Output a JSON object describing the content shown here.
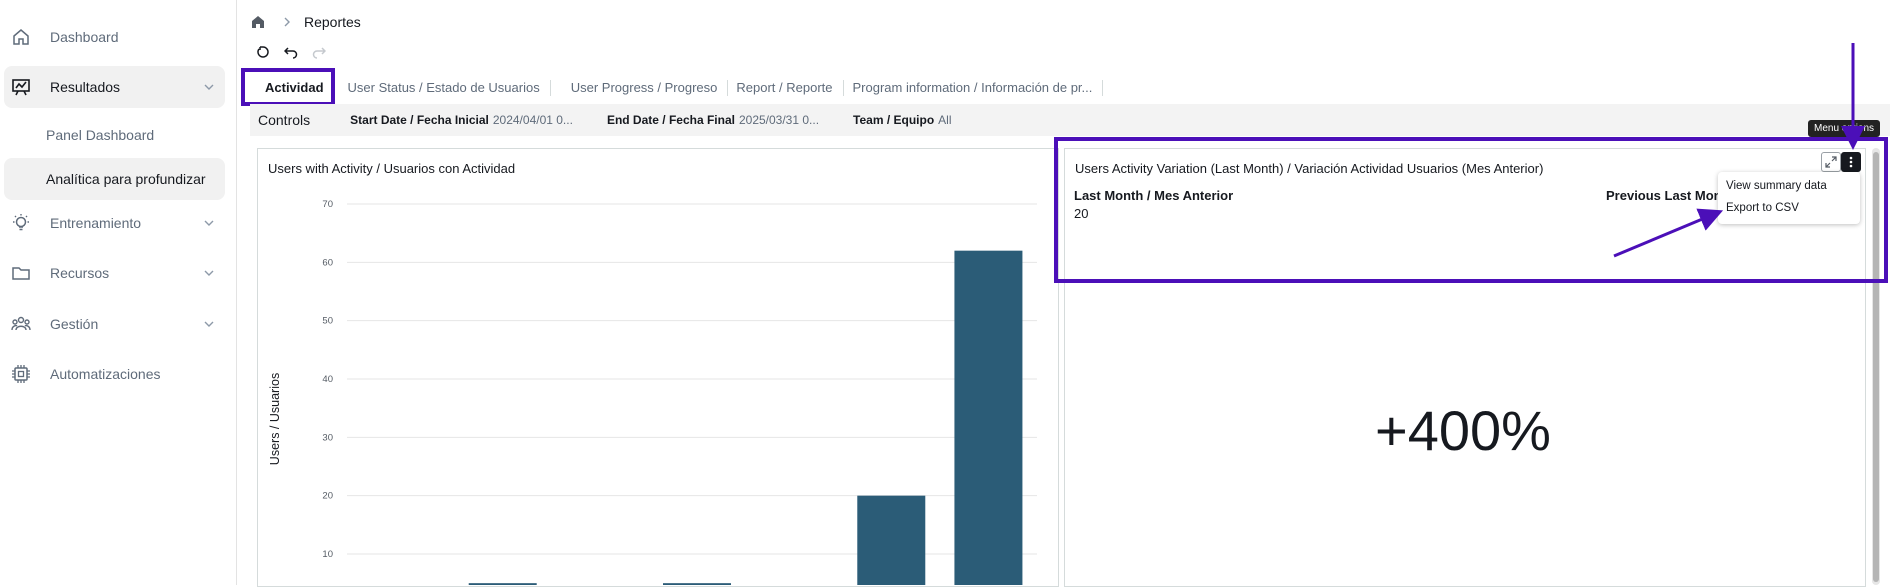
{
  "sidebar": {
    "items": [
      {
        "label": "Dashboard",
        "icon": "home-icon"
      },
      {
        "label": "Resultados",
        "icon": "chart-board-icon"
      },
      {
        "label": "Entrenamiento",
        "icon": "bulb-icon"
      },
      {
        "label": "Recursos",
        "icon": "folder-icon"
      },
      {
        "label": "Gestión",
        "icon": "users-icon"
      },
      {
        "label": "Automatizaciones",
        "icon": "chip-icon"
      }
    ],
    "sub_items": [
      {
        "label": "Panel Dashboard"
      },
      {
        "label": "Analítica para profundizar"
      }
    ]
  },
  "breadcrumb": {
    "current": "Reportes"
  },
  "tabs": [
    {
      "label": "Actividad"
    },
    {
      "label": "User Status / Estado de Usuarios"
    },
    {
      "label": "User Progress / Progreso"
    },
    {
      "label": "Report / Reporte"
    },
    {
      "label": "Program information / Información de pr..."
    }
  ],
  "controls": {
    "title": "Controls",
    "start_label": "Start Date / Fecha Inicial",
    "start_value": "2024/04/01 0...",
    "end_label": "End Date / Fecha Final",
    "end_value": "2025/03/31 0...",
    "team_label": "Team / Equipo",
    "team_value": "All"
  },
  "chart_card": {
    "title": "Users with Activity / Usuarios con Actividad"
  },
  "kpi_card": {
    "title": "Users Activity Variation (Last Month) / Variación Actividad Usuarios  (Mes Anterior)",
    "last_month_label": "Last Month / Mes Anterior",
    "last_month_value": "20",
    "previous_label": "Previous Last Month",
    "change": "+400%"
  },
  "menu": {
    "tooltip": "Menu options",
    "items": [
      {
        "label": "View summary data"
      },
      {
        "label": "Export to CSV"
      }
    ]
  },
  "colors": {
    "accent": "#4b0fb8",
    "bar": "#2b5c77"
  },
  "chart_data": {
    "type": "bar",
    "ylabel": "Users / Usuarios",
    "ylim": [
      0,
      70
    ],
    "yticks": [
      10,
      20,
      30,
      40,
      50,
      60,
      70
    ],
    "values": [
      0,
      5,
      0,
      5,
      0,
      20,
      62
    ]
  }
}
